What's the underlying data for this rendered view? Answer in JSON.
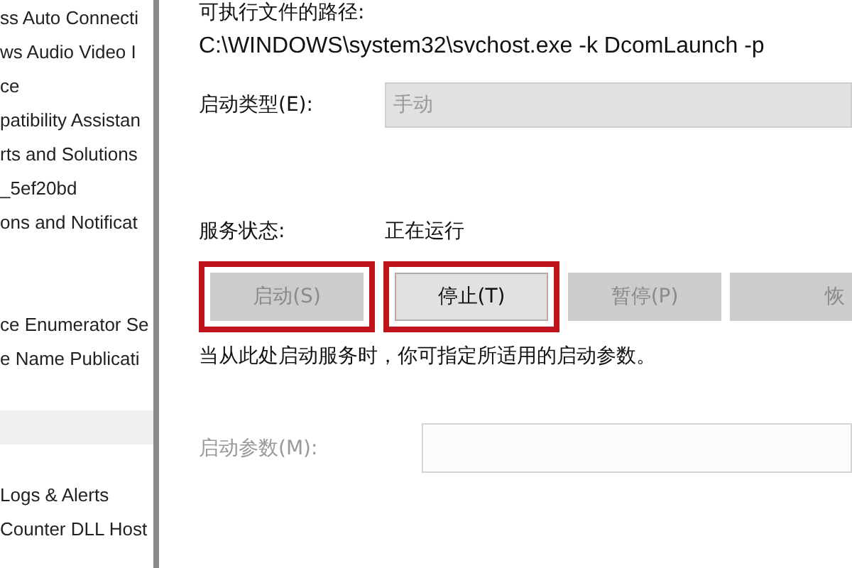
{
  "service_list": {
    "items": [
      {
        "kind": "row",
        "label": "ss Auto Connecti",
        "selected": false
      },
      {
        "kind": "row",
        "label": "ws Audio Video I",
        "selected": false
      },
      {
        "kind": "row",
        "label": "ce",
        "selected": false
      },
      {
        "kind": "row",
        "label": "patibility Assistan",
        "selected": false
      },
      {
        "kind": "row",
        "label": "rts and Solutions",
        "selected": false
      },
      {
        "kind": "row",
        "label": "_5ef20bd",
        "selected": false
      },
      {
        "kind": "row",
        "label": "ons and Notificat",
        "selected": false
      },
      {
        "kind": "blank"
      },
      {
        "kind": "blank"
      },
      {
        "kind": "row",
        "label": "ce Enumerator Se",
        "selected": false
      },
      {
        "kind": "row",
        "label": "e Name Publicati",
        "selected": false
      },
      {
        "kind": "blank"
      },
      {
        "kind": "group"
      },
      {
        "kind": "blank"
      },
      {
        "kind": "row",
        "label": "Logs & Alerts",
        "selected": false
      },
      {
        "kind": "row",
        "label": "Counter DLL Host",
        "selected": false
      }
    ]
  },
  "dialog": {
    "path_label": "可执行文件的路径:",
    "path_value": "C:\\WINDOWS\\system32\\svchost.exe -k DcomLaunch -p",
    "startup_type": {
      "label": "启动类型(E):",
      "value": "手动",
      "disabled": true
    },
    "status": {
      "label": "服务状态:",
      "value": "正在运行"
    },
    "buttons": [
      {
        "label": "启动(S)",
        "disabled": true,
        "highlighted": true
      },
      {
        "label": "停止(T)",
        "disabled": false,
        "highlighted": true
      },
      {
        "label": "暂停(P)",
        "disabled": true,
        "highlighted": false
      },
      {
        "label": "恢",
        "disabled": true,
        "highlighted": false
      }
    ],
    "hint": "当从此处启动服务时，你可指定所适用的启动参数。",
    "parameters": {
      "label": "启动参数(M):",
      "disabled": true
    }
  }
}
